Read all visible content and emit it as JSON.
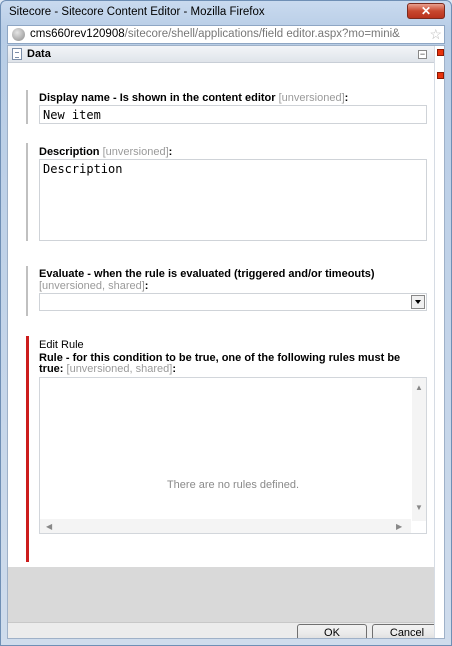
{
  "window": {
    "title": "Sitecore - Sitecore Content Editor - Mozilla Firefox",
    "close_label": "✕"
  },
  "urlbar": {
    "host": "cms660rev120908",
    "path": "/sitecore/shell/applications/field editor.aspx?mo=mini&"
  },
  "section": {
    "title": "Data",
    "collapse_label": "−"
  },
  "fields": {
    "display_name": {
      "label": "Display name - Is shown in the content editor",
      "meta": "[unversioned]",
      "suffix": ":",
      "value": "New item"
    },
    "description": {
      "label": "Description",
      "meta": "[unversioned]",
      "suffix": ":",
      "value": "Description"
    },
    "evaluate": {
      "label": "Evaluate - when the rule is evaluated (triggered and/or timeouts)",
      "meta": "[unversioned, shared]",
      "suffix": ":",
      "value": ""
    },
    "rule": {
      "link": "Edit Rule",
      "label_line1": "Rule - for this condition to be true, one of the following rules must be",
      "label_line2": "true:",
      "meta": "[unversioned, shared]",
      "suffix": ":",
      "empty_text": "There are no rules defined."
    }
  },
  "footer": {
    "ok_label": "OK",
    "cancel_label": "Cancel"
  },
  "colors": {
    "required_bar": "#cc1c1c",
    "marker": "#e8320c"
  }
}
